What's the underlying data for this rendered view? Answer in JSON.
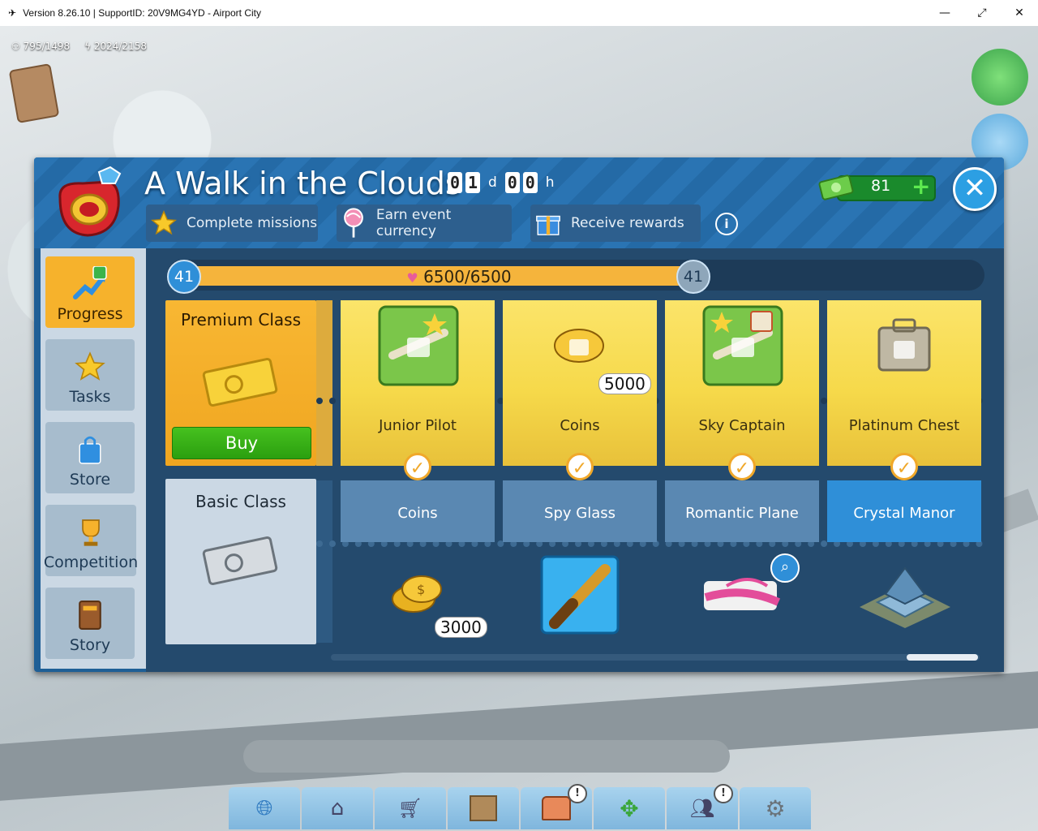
{
  "window": {
    "title": "Version 8.26.10 | SupportID: 20V9MG4YD - Airport City",
    "minimize": "—",
    "restore": "⤢",
    "close": "✕"
  },
  "hud": {
    "population": "795/1498",
    "energy": "2024/2158"
  },
  "event": {
    "title": "A Walk in the Clouds",
    "timer": {
      "days": [
        "0",
        "1"
      ],
      "days_unit": "d",
      "hours": [
        "0",
        "0"
      ],
      "hours_unit": "h"
    },
    "steps": [
      {
        "label": "Complete missions",
        "icon": "star-icon"
      },
      {
        "label": "Earn event currency",
        "icon": "lollipop-icon"
      },
      {
        "label": "Receive rewards",
        "icon": "gift-icon"
      }
    ],
    "info": "i",
    "currency": {
      "value": "81",
      "icon": "cash-icon",
      "plus": "+"
    },
    "close": "✕"
  },
  "sidebar": {
    "items": [
      {
        "label": "Progress",
        "icon": "progress-chart-icon",
        "active": true
      },
      {
        "label": "Tasks",
        "icon": "star-icon",
        "active": false
      },
      {
        "label": "Store",
        "icon": "shopping-bag-icon",
        "active": false
      },
      {
        "label": "Competition",
        "icon": "trophy-icon",
        "active": false
      },
      {
        "label": "Story",
        "icon": "book-icon",
        "active": false
      }
    ]
  },
  "progress": {
    "level_current": "41",
    "level_next": "41",
    "text": "6500/6500",
    "fraction": 1.0
  },
  "classes": {
    "premium": {
      "label": "Premium Class",
      "buy": "Buy",
      "icon": "golden-ticket-icon"
    },
    "basic": {
      "label": "Basic Class",
      "icon": "silver-ticket-icon"
    }
  },
  "rewards": [
    {
      "premium": {
        "label": "Junior Pilot",
        "icon": "locked-plane-badge-icon",
        "locked": true
      },
      "basic": {
        "label": "Coins",
        "icon": "coins-icon",
        "qty": "3000",
        "highlight": false
      }
    },
    {
      "premium": {
        "label": "Coins",
        "icon": "locked-coins-icon",
        "qty": "5000",
        "locked": true
      },
      "basic": {
        "label": "Spy Glass",
        "icon": "spyglass-icon",
        "highlight": false
      }
    },
    {
      "premium": {
        "label": "Sky Captain",
        "icon": "locked-captain-badge-icon",
        "locked": true
      },
      "basic": {
        "label": "Romantic Plane",
        "icon": "romantic-plane-icon",
        "highlight": false
      }
    },
    {
      "premium": {
        "label": "Platinum Chest",
        "icon": "locked-chest-icon",
        "locked": true
      },
      "basic": {
        "label": "Crystal Manor",
        "icon": "crystal-manor-icon",
        "highlight": true
      }
    }
  ],
  "toolbar": [
    {
      "icon": "globe-plane-icon",
      "alert": false
    },
    {
      "icon": "hangar-icon",
      "alert": false
    },
    {
      "icon": "cart-icon",
      "alert": false
    },
    {
      "icon": "crate-icon",
      "alert": false
    },
    {
      "icon": "treasure-chest-icon",
      "alert": true
    },
    {
      "icon": "move-arrows-icon",
      "alert": false
    },
    {
      "icon": "friends-icon",
      "alert": true
    },
    {
      "icon": "settings-gear-icon",
      "alert": false
    }
  ],
  "colors": {
    "panel": "#1f5f96",
    "accent_orange": "#f6b22c",
    "buy_green": "#2b9f0f",
    "premium_yellow": "#f6d94a",
    "basic_blue": "#5a88b2",
    "highlight_blue": "#2f8fd8"
  }
}
